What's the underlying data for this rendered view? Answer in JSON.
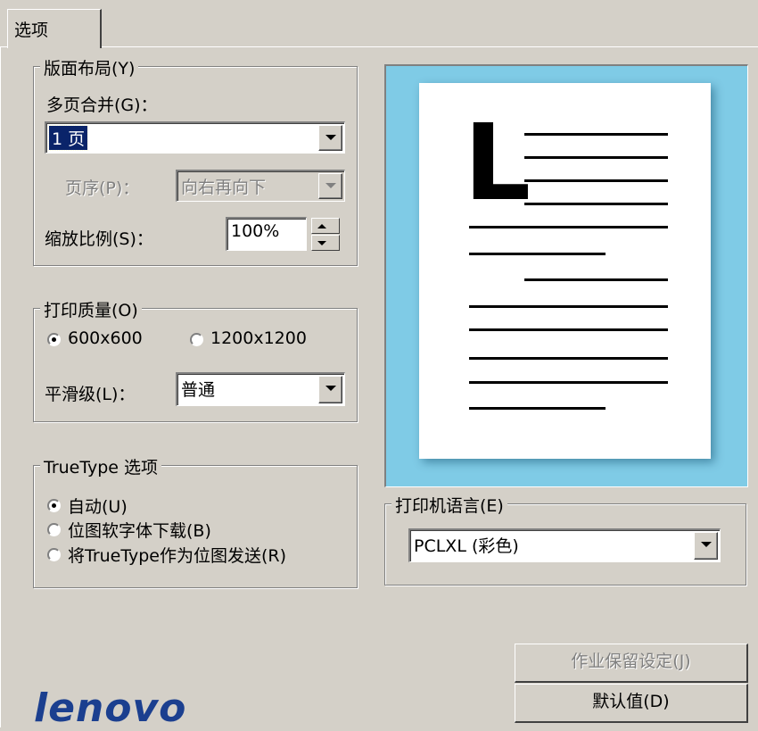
{
  "tab": {
    "label": "选项"
  },
  "layout_group": {
    "legend": "版面布局(Y)",
    "pages_per_sheet": {
      "label": "多页合并(G)：",
      "value": "1 页"
    },
    "page_order": {
      "label": "页序(P)：",
      "value": "向右再向下"
    },
    "scaling": {
      "label": "缩放比例(S)：",
      "value": "100%"
    }
  },
  "quality_group": {
    "legend": "打印质量(O)",
    "radio_600": "600x600",
    "radio_1200": "1200x1200",
    "selected": "600x600",
    "smoothing": {
      "label": "平滑级(L)：",
      "value": "普通"
    }
  },
  "truetype_group": {
    "legend": "TrueType 选项",
    "options": [
      "自动(U)",
      "位图软字体下载(B)",
      "将TrueType作为位图发送(R)"
    ],
    "selected": "自动(U)"
  },
  "preview": {
    "letter": "L"
  },
  "language_group": {
    "legend": "打印机语言(E)",
    "value": "PCLXL (彩色)"
  },
  "buttons": {
    "job_retention": "作业保留设定(J)",
    "defaults": "默认值(D)"
  },
  "logo": {
    "text": "lenovo",
    "color": "#1b3f8f"
  },
  "colors": {
    "selection": "#0a246a",
    "preview_bg": "#7fcbe6",
    "face": "#d4d0c8"
  }
}
